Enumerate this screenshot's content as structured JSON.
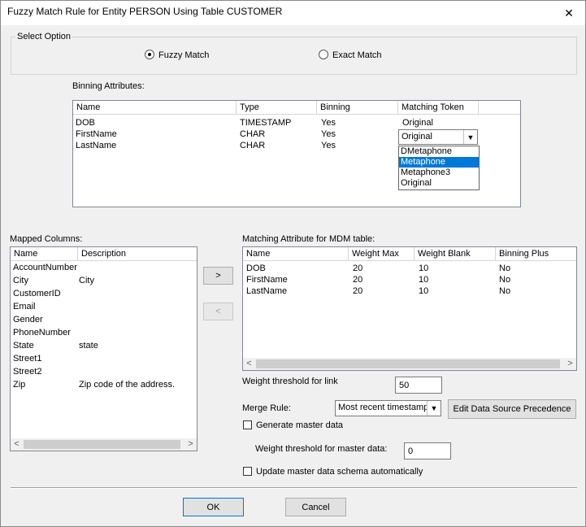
{
  "window": {
    "title": "Fuzzy Match Rule for Entity PERSON Using Table CUSTOMER",
    "close_glyph": "✕"
  },
  "select_option": {
    "legend": "Select Option",
    "fuzzy_label": "Fuzzy Match",
    "exact_label": "Exact Match",
    "selected": "Fuzzy Match"
  },
  "binning": {
    "label": "Binning Attributes:",
    "headers": [
      "Name",
      "Type",
      "Binning",
      "Matching Token"
    ],
    "rows": [
      {
        "name": "DOB",
        "type": "TIMESTAMP",
        "binning": "Yes",
        "token": "Original"
      },
      {
        "name": "FirstName",
        "type": "CHAR",
        "binning": "Yes",
        "token": "Original"
      },
      {
        "name": "LastName",
        "type": "CHAR",
        "binning": "Yes",
        "token": ""
      }
    ],
    "dropdown_options": [
      "DMetaphone",
      "Metaphone",
      "Metaphone3",
      "Original"
    ],
    "dropdown_highlighted": "Metaphone"
  },
  "mapped": {
    "label": "Mapped Columns:",
    "headers": [
      "Name",
      "Description"
    ],
    "rows": [
      {
        "name": "AccountNumber",
        "desc": ""
      },
      {
        "name": "City",
        "desc": "City"
      },
      {
        "name": "CustomerID",
        "desc": ""
      },
      {
        "name": "Email",
        "desc": ""
      },
      {
        "name": "Gender",
        "desc": ""
      },
      {
        "name": "PhoneNumber",
        "desc": ""
      },
      {
        "name": "State",
        "desc": "state"
      },
      {
        "name": "Street1",
        "desc": ""
      },
      {
        "name": "Street2",
        "desc": ""
      },
      {
        "name": "Zip",
        "desc": "Zip code of the address."
      }
    ]
  },
  "move_buttons": {
    "add": ">",
    "remove": "<"
  },
  "matching": {
    "label": "Matching Attribute for MDM table:",
    "headers": [
      "Name",
      "Weight Max",
      "Weight Blank",
      "Binning Plus"
    ],
    "rows": [
      {
        "name": "DOB",
        "max": "20",
        "blank": "10",
        "plus": "No"
      },
      {
        "name": "FirstName",
        "max": "20",
        "blank": "10",
        "plus": "No"
      },
      {
        "name": "LastName",
        "max": "20",
        "blank": "10",
        "plus": "No"
      }
    ]
  },
  "settings": {
    "weight_link_label": "Weight threshold for link",
    "weight_link_value": "50",
    "merge_rule_label": "Merge Rule:",
    "merge_rule_value": "Most recent timestamp",
    "edit_precedence_label": "Edit Data Source Precedence",
    "generate_master_label": "Generate master data",
    "weight_master_label": "Weight threshold for master data:",
    "weight_master_value": "0",
    "update_schema_label": "Update master data schema automatically"
  },
  "footer": {
    "ok_label": "OK",
    "cancel_label": "Cancel"
  }
}
